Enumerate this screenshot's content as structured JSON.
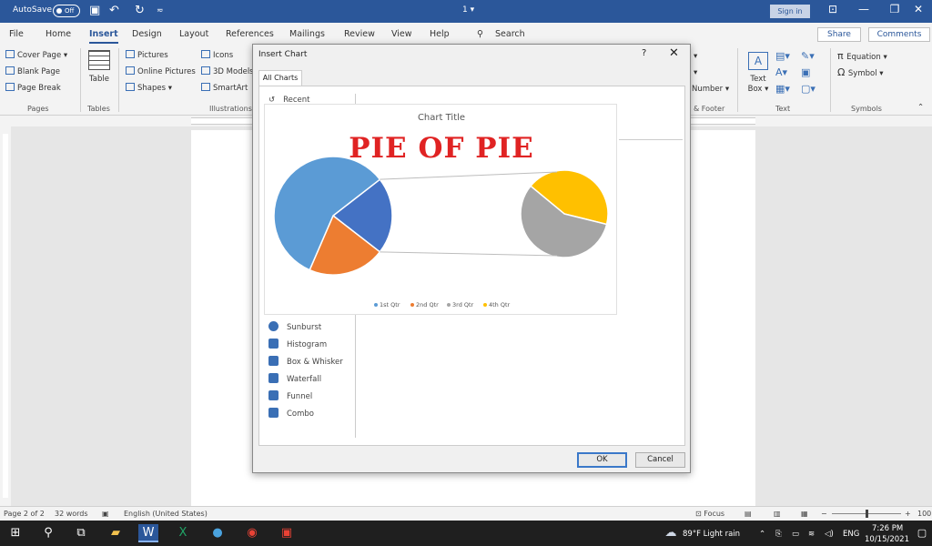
{
  "titlebar": {
    "autosave": "AutoSave",
    "toggle": "Off",
    "doc_title": "1 ▾",
    "signin": "Sign in"
  },
  "menu": {
    "tabs": [
      "File",
      "Home",
      "Insert",
      "Design",
      "Layout",
      "References",
      "Mailings",
      "Review",
      "View",
      "Help"
    ],
    "search": "Search",
    "share": "Share",
    "comments": "Comments"
  },
  "ribbon": {
    "pages": [
      "Cover Page ▾",
      "Blank Page",
      "Page Break"
    ],
    "pages_label": "Pages",
    "table": "Table",
    "tables_label": "Tables",
    "illustrations": [
      "Pictures",
      "Online Pictures",
      "Shapes ▾"
    ],
    "illustrations2": [
      "Icons",
      "3D Models",
      "SmartArt"
    ],
    "illustrations_label": "Illustrations",
    "number": "Number ▾",
    "header_footer_label": "& Footer",
    "textbox": "Text Box ▾",
    "text_label": "Text",
    "equation": "Equation ▾",
    "symbol": "Symbol ▾",
    "symbols_label": "Symbols"
  },
  "dialog": {
    "title": "Insert Chart",
    "help": "?",
    "close": "✕",
    "tab": "All Charts",
    "recent": "Recent",
    "chart_types": [
      "Sunburst",
      "Histogram",
      "Box & Whisker",
      "Waterfall",
      "Funnel",
      "Combo"
    ],
    "ok": "OK",
    "cancel": "Cancel"
  },
  "preview": {
    "chart_title": "Chart Title",
    "overlay": "PIE OF PIE"
  },
  "chart_data": {
    "type": "pie",
    "subtype": "pie-of-pie",
    "title": "Chart Title",
    "series": [
      {
        "name": "1st Qtr",
        "color": "#5b9bd5",
        "value": 58
      },
      {
        "name": "2nd Qtr",
        "color": "#ed7d31",
        "value": 21
      },
      {
        "name": "3rd Qtr",
        "color": "#a5a5a5",
        "value": 12
      },
      {
        "name": "4th Qtr",
        "color": "#ffc000",
        "value": 9
      }
    ],
    "secondary_pie": [
      "3rd Qtr",
      "4th Qtr"
    ],
    "main_pie_bundle_color": "#4472c4",
    "legend_position": "bottom"
  },
  "statusbar": {
    "page": "Page 2 of 2",
    "words": "32 words",
    "language": "English (United States)",
    "focus": "Focus",
    "zoom": "100"
  },
  "taskbar": {
    "weather": "89°F  Light rain",
    "lang": "ENG",
    "time": "7:26 PM",
    "date": "10/15/2021"
  }
}
